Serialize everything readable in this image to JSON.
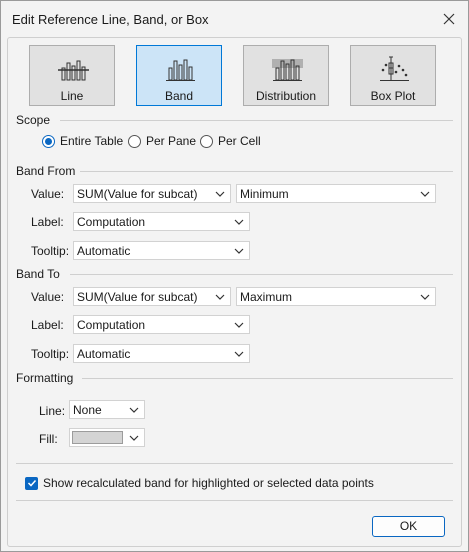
{
  "window": {
    "title": "Edit Reference Line, Band, or Box"
  },
  "types": [
    {
      "label": "Line",
      "icon": "line-chart-icon",
      "selected": false
    },
    {
      "label": "Band",
      "icon": "band-chart-icon",
      "selected": true
    },
    {
      "label": "Distribution",
      "icon": "distribution-chart-icon",
      "selected": false
    },
    {
      "label": "Box Plot",
      "icon": "box-plot-icon",
      "selected": false
    }
  ],
  "scope": {
    "title": "Scope",
    "options": [
      "Entire Table",
      "Per Pane",
      "Per Cell"
    ],
    "selected": "Entire Table"
  },
  "band_from": {
    "title": "Band From",
    "value_label": "Value:",
    "value": "SUM(Value for subcat)",
    "aggregation": "Minimum",
    "label_label": "Label:",
    "label_value": "Computation",
    "tooltip_label": "Tooltip:",
    "tooltip_value": "Automatic"
  },
  "band_to": {
    "title": "Band To",
    "value_label": "Value:",
    "value": "SUM(Value for subcat)",
    "aggregation": "Maximum",
    "label_label": "Label:",
    "label_value": "Computation",
    "tooltip_label": "Tooltip:",
    "tooltip_value": "Automatic"
  },
  "formatting": {
    "title": "Formatting",
    "line_label": "Line:",
    "line_value": "None",
    "fill_label": "Fill:",
    "fill_color": "#d4d4d4"
  },
  "recalc": {
    "label": "Show recalculated band for highlighted or selected data points",
    "checked": true
  },
  "ok_label": "OK",
  "colors": {
    "accent": "#0a67c2",
    "selected_bg": "#cce4f7"
  }
}
